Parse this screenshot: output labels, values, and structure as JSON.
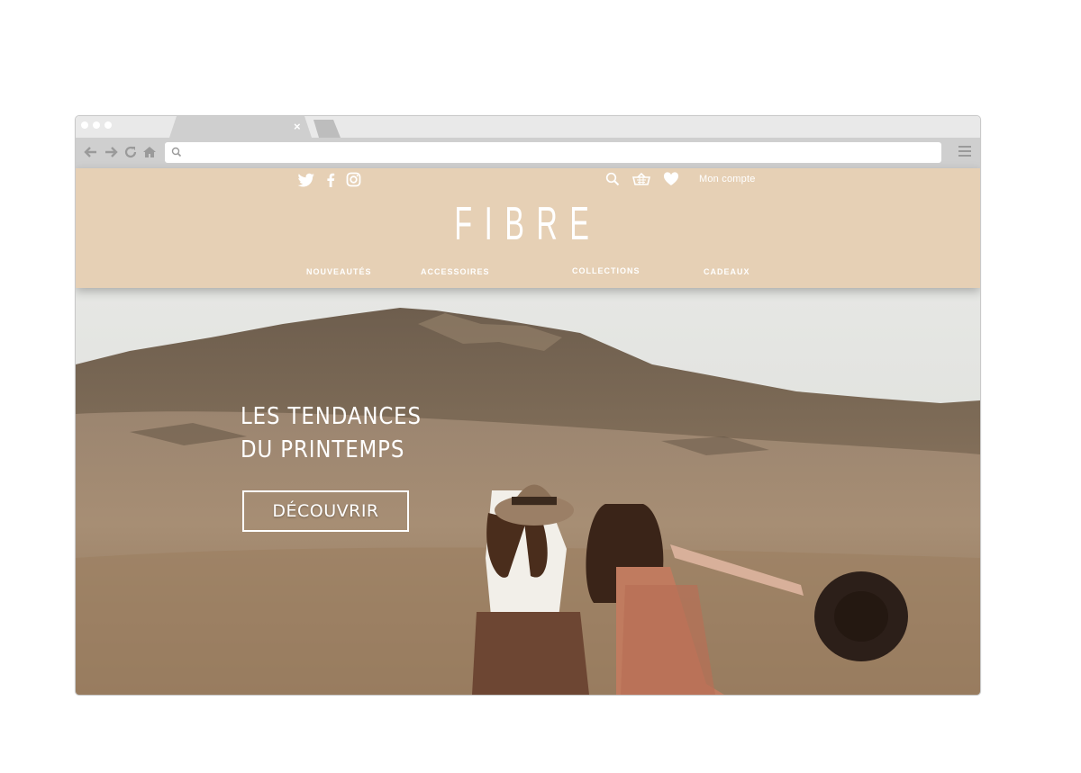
{
  "browser": {
    "tab_close_glyph": "×",
    "url_value": "",
    "nav_icons": [
      "arrow-left-icon",
      "arrow-right-icon",
      "reload-icon",
      "home-icon"
    ]
  },
  "site": {
    "social_icons": [
      "twitter-icon",
      "facebook-icon",
      "instagram-icon"
    ],
    "util_icons": [
      "search-icon",
      "basket-icon",
      "heart-icon"
    ],
    "account_label": "Mon compte",
    "logo": "FIBRE",
    "nav": [
      "NOUVEAUTÉS",
      "ACCESSOIRES",
      "COLLECTIONS",
      "CADEAUX"
    ],
    "colors": {
      "header_bg": "#e6d0b5",
      "header_text": "#ffffff"
    }
  },
  "hero": {
    "title_line1": "LES TENDANCES",
    "title_line2": "DU PRINTEMPS",
    "cta_label": "DÉCOUVRIR"
  }
}
